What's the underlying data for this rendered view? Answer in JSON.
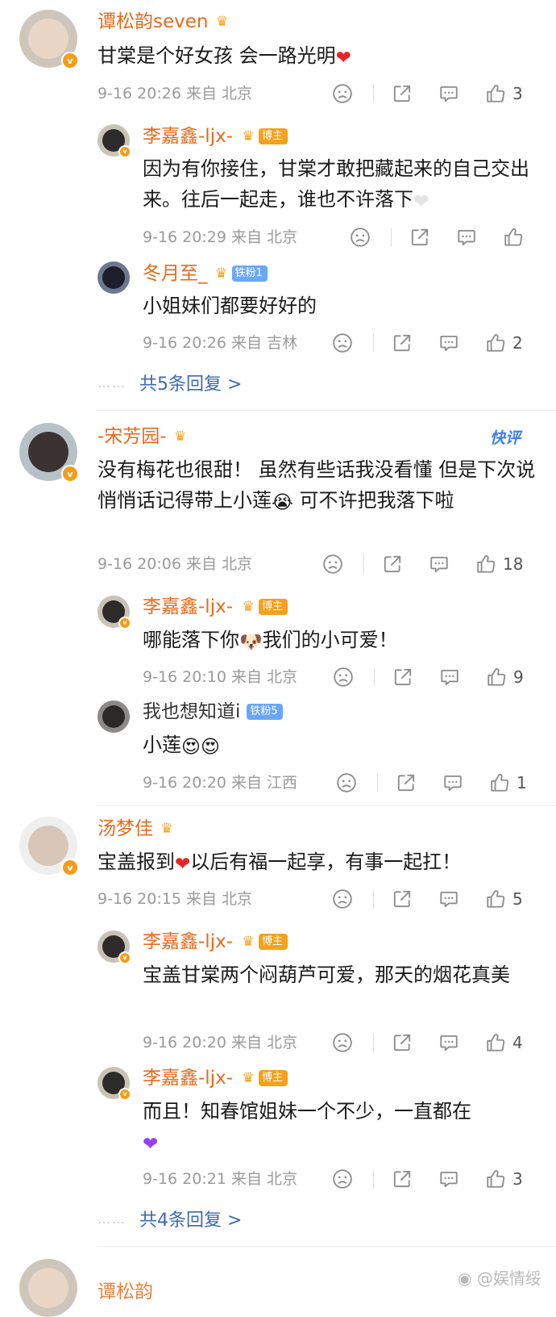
{
  "colors": {
    "name": "#e86a1a",
    "link": "#3c6ab1",
    "meta": "#9a9a9a",
    "badge": "#f39d19",
    "fan_tag": "#6aa7f8",
    "blogger_tag": "#f4a11b"
  },
  "icons": {
    "dislike": "frown-face-icon",
    "share": "share-icon",
    "comment": "comment-icon",
    "like": "thumbs-up-icon"
  },
  "comments": [
    {
      "user": "谭松韵seven",
      "text": "甘棠是个好女孩 会一路光明",
      "time": "9-16 20:26",
      "location": "来自 北京",
      "likes": "3",
      "replies": [
        {
          "user": "李嘉鑫-ljx-",
          "tag": "博主",
          "text": "因为有你接住，甘棠才敢把藏起来的自己交出来。往后一起走，谁也不许落下",
          "time": "9-16 20:29",
          "location": "来自 北京",
          "likes": ""
        },
        {
          "user": "冬月至_",
          "tag": "铁粉1",
          "text": "小姐妹们都要好好的",
          "time": "9-16 20:26",
          "location": "来自 吉林",
          "likes": "2"
        }
      ],
      "more_replies": "共5条回复 >"
    },
    {
      "user": "-宋芳园-",
      "badge_label": "快评",
      "text": "没有梅花也很甜！ 虽然有些话我没看懂 但是下次说悄悄话记得带上小莲",
      "text_tail": "可不许把我落下啦",
      "time": "9-16 20:06",
      "location": "来自 北京",
      "likes": "18",
      "replies": [
        {
          "user": "李嘉鑫-ljx-",
          "tag": "博主",
          "text": "哪能落下你",
          "text_tail": "我们的小可爱！",
          "time": "9-16 20:10",
          "location": "来自 北京",
          "likes": "9"
        },
        {
          "user": "我也想知道i",
          "tag": "铁粉5",
          "text": "小莲",
          "time": "9-16 20:20",
          "location": "来自 江西",
          "likes": "1"
        }
      ]
    },
    {
      "user": "汤梦佳",
      "text": "宝盖报到",
      "text_tail": "以后有福一起享，有事一起扛！",
      "time": "9-16 20:15",
      "location": "来自 北京",
      "likes": "5",
      "replies": [
        {
          "user": "李嘉鑫-ljx-",
          "tag": "博主",
          "text": "宝盖甘棠两个闷葫芦可爱，那天的烟花真美",
          "time": "9-16 20:20",
          "location": "来自 北京",
          "likes": "4"
        },
        {
          "user": "李嘉鑫-ljx-",
          "tag": "博主",
          "text": "而且！知春馆姐妹一个不少，一直都在",
          "time": "9-16 20:21",
          "location": "来自 北京",
          "likes": "3"
        }
      ],
      "more_replies": "共4条回复 >"
    }
  ],
  "next_user_partial": "谭松韵",
  "watermark": "@娱情绥"
}
